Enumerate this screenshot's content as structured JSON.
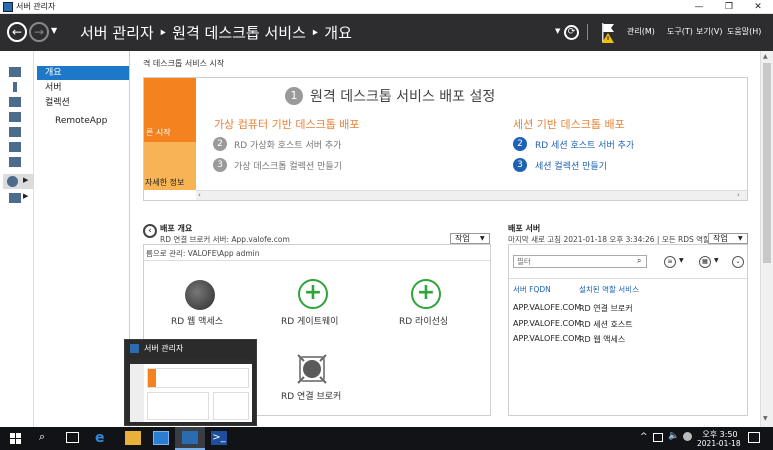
{
  "window": {
    "title": "서버 관리자",
    "buttons": [
      "—",
      "❐",
      "✕"
    ]
  },
  "header": {
    "back_icon": "back-arrow-icon",
    "forward_icon": "forward-arrow-icon",
    "breadcrumb": "서버 관리자 ‣ 원격 데스크톱 서비스 ‣ 개요",
    "refresh_icon": "refresh-icon",
    "flag_icon": "warning-flag-icon",
    "menu": [
      "관리(M)",
      "도구(T)",
      "보기(V)",
      "도움말(H)"
    ]
  },
  "sidebar": {
    "items": [
      {
        "label": "개요",
        "active": true
      },
      {
        "label": "서버",
        "active": false
      },
      {
        "label": "컬렉션",
        "active": false
      },
      {
        "label": "RemoteApp",
        "active": false
      }
    ]
  },
  "quick_start": {
    "section_title": "격 데스크톱 서비스 시작",
    "orange_top_label": "른 시작",
    "orange_bottom_label": "자세한 정보",
    "main_number": "1",
    "main_title": "원격 데스크톱 서비스 배포 설정",
    "left_heading": "가상 컴퓨터 기반 데스크톱 배포",
    "left_steps": [
      {
        "num": "2",
        "label": "RD 가상화 호스트 서버 추가"
      },
      {
        "num": "3",
        "label": "가상 데스크톱 컬렉션 만들기"
      }
    ],
    "right_heading": "세션 기반 데스크톱 배포",
    "right_steps": [
      {
        "num": "2",
        "label": "RD 세션 호스트 서버 추가"
      },
      {
        "num": "3",
        "label": "세션 컬렉션 만들기"
      }
    ]
  },
  "deployment_overview": {
    "title": "배포 개요",
    "subtitle": "RD 연결 브로커 서버: App.valofe.com",
    "managed_as": "름으로 관리: VALOFE\\App admin",
    "tasks_label": "작업",
    "roles": [
      {
        "label": "RD 웹 액세스",
        "kind": "globe"
      },
      {
        "label": "RD 게이트웨이",
        "kind": "plus"
      },
      {
        "label": "RD 라이선싱",
        "kind": "plus"
      },
      {
        "label": "RD 연결 브로커",
        "kind": "broker"
      }
    ]
  },
  "deployment_servers": {
    "title": "배포 서버",
    "subtitle": "마지막 새로 고침 2021-01-18 오후 3:34:26 | 모든 RDS 역할...",
    "tasks_label": "작업",
    "filter_placeholder": "필터",
    "columns": [
      "서버 FQDN",
      "설치된 역할 서비스"
    ],
    "rows": [
      [
        "APP.VALOFE.COM",
        "RD 연결 브로커"
      ],
      [
        "APP.VALOFE.COM",
        "RD 세션 호스트"
      ],
      [
        "APP.VALOFE.COM",
        "RD 웹 액세스"
      ]
    ]
  },
  "preview": {
    "title": "서버 관리자"
  },
  "taskbar": {
    "time": "오후 3:50",
    "date": "2021-01-18"
  }
}
